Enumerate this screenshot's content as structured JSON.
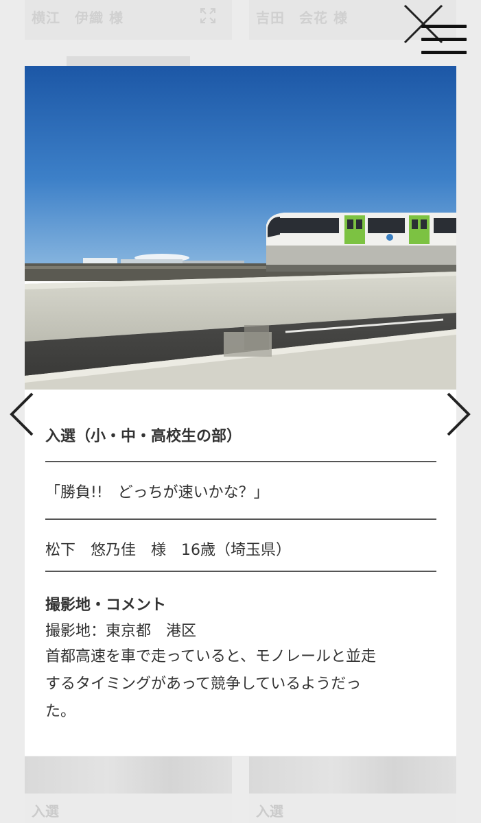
{
  "background": {
    "top_left_name": "横江　伊織 様",
    "top_right_name": "吉田　会花 様",
    "bottom_left_award": "入選",
    "bottom_right_award": "入選"
  },
  "header": {
    "close_icon": "close-icon",
    "menu_icon": "hamburger-menu-icon"
  },
  "modal": {
    "award": "入選（小・中・高校生の部）",
    "photo_title": "「勝負!!　どっちが速いかな？」",
    "author": "松下　悠乃佳　様　16歳（埼玉県）",
    "comment_heading": "撮影地・コメント",
    "location": "撮影地：東京都　港区",
    "comment_lines": [
      "首都高速を車で走っていると、モノレールと並走",
      "するタイミングがあって競争しているようだっ",
      "た。"
    ]
  },
  "nav": {
    "prev_icon": "chevron-left-icon",
    "next_icon": "chevron-right-icon"
  },
  "colors": {
    "sky_top": "#1f5aa8",
    "sky_bottom": "#6fa4d8",
    "train_green": "#7cc242",
    "text": "#333333",
    "rule": "#555555"
  }
}
